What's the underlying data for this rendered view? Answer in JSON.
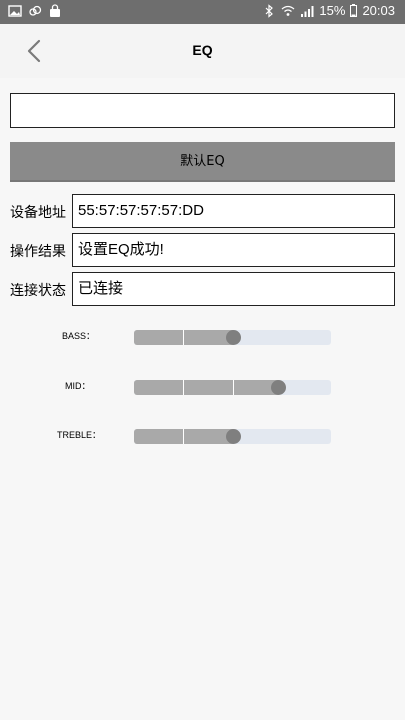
{
  "status_bar": {
    "left_icons": [
      "image-icon",
      "cloud-icon",
      "bag-icon"
    ],
    "right_icons": [
      "bluetooth-icon",
      "wifi-icon",
      "signal-icon"
    ],
    "battery": "15%",
    "time": "20:03"
  },
  "app_bar": {
    "title": "EQ"
  },
  "input": {
    "value": ""
  },
  "default_button": "默认EQ",
  "info": {
    "address_label": "设备地址",
    "address_value": "55:57:57:57:57:DD",
    "result_label": "操作结果",
    "result_value": "设置EQ成功!",
    "status_label": "连接状态",
    "status_value": "已连接"
  },
  "sliders": [
    {
      "label": "BASS：",
      "value": 0.5
    },
    {
      "label": "MID：",
      "value": 0.73
    },
    {
      "label": "TREBLE：",
      "value": 0.5
    }
  ],
  "colors": {
    "status_bar_bg": "#6e6e6e",
    "button_bg": "#8a8a8a",
    "slider_fill": "#a9a9a9",
    "slider_track": "#e3e8f0",
    "slider_thumb": "#7f7f7f"
  }
}
